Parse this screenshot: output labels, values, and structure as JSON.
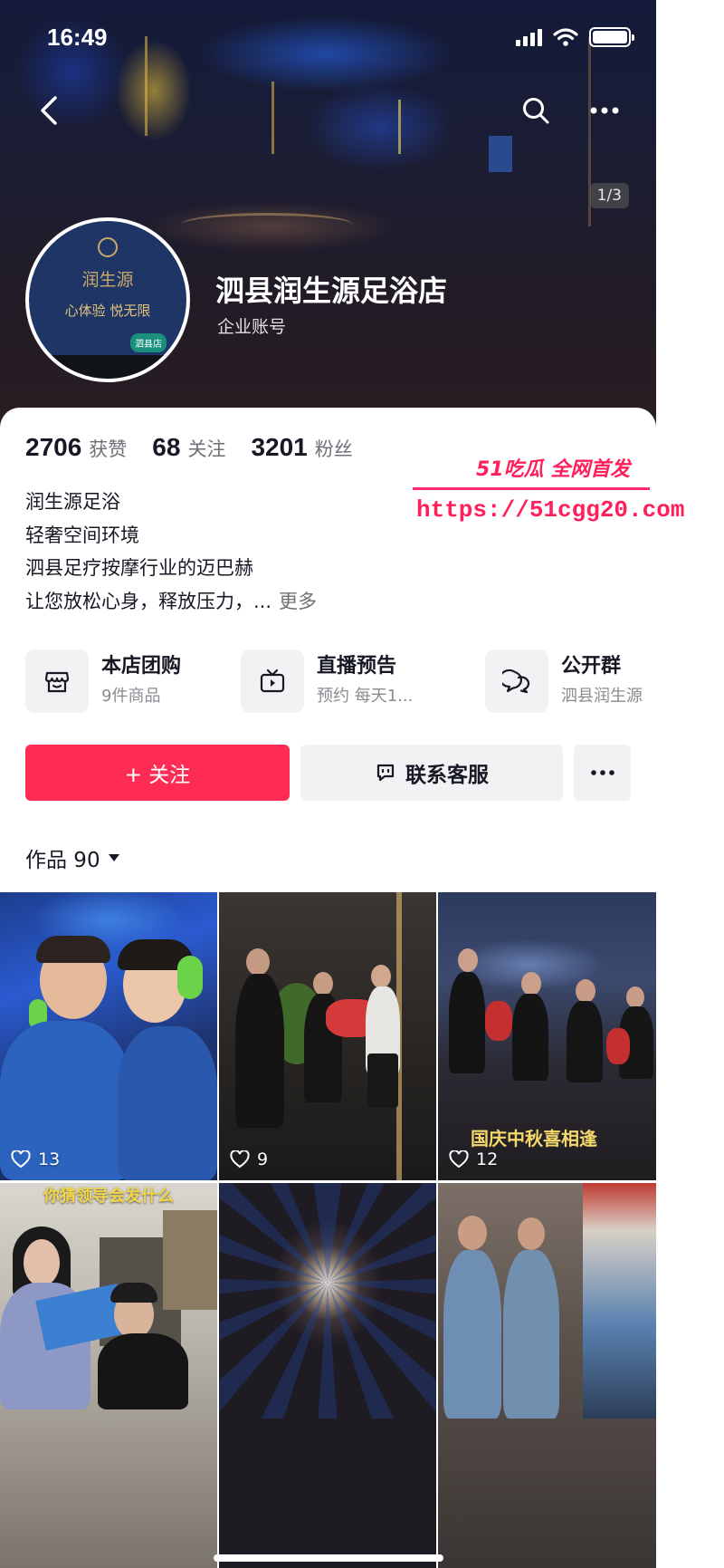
{
  "status_bar": {
    "time": "16:49"
  },
  "cover": {
    "page_indicator": "1/3"
  },
  "profile": {
    "name": "泗县润生源足浴店",
    "account_type": "企业账号",
    "avatar_logo": {
      "brand": "润生源",
      "slogan": "心体验 悦无限",
      "tag": "泗县店"
    }
  },
  "stats": [
    {
      "value": "2706",
      "label": "获赞"
    },
    {
      "value": "68",
      "label": "关注"
    },
    {
      "value": "3201",
      "label": "粉丝"
    }
  ],
  "watermark": {
    "brand": "51吃瓜 全网首发",
    "url": "https://51cgg20.com"
  },
  "bio": {
    "lines": [
      "润生源足浴",
      "轻奢空间环境",
      "泗县足疗按摩行业的迈巴赫",
      "让您放松心身，释放压力，..."
    ],
    "more_label": "更多"
  },
  "services": [
    {
      "icon": "store-icon",
      "title": "本店团购",
      "subtitle": "9件商品"
    },
    {
      "icon": "tv-icon",
      "title": "直播预告",
      "subtitle": "预约 每天1..."
    },
    {
      "icon": "chat-group-icon",
      "title": "公开群",
      "subtitle": "泗县润生源"
    }
  ],
  "actions": {
    "follow_label": "+ 关注",
    "contact_label": "联系客服"
  },
  "works": {
    "label": "作品 90"
  },
  "videos": [
    {
      "likes": "13",
      "caption": ""
    },
    {
      "likes": "9",
      "caption": ""
    },
    {
      "likes": "12",
      "caption": "国庆中秋喜相逢"
    },
    {
      "likes": "",
      "caption": "你猜领导会发什么"
    },
    {
      "likes": "",
      "caption": ""
    },
    {
      "likes": "",
      "caption": ""
    }
  ],
  "colors": {
    "accent": "#fe2c55",
    "watermark": "#ff1f5a",
    "text": "#161823",
    "secondary_text": "#6f7077"
  }
}
